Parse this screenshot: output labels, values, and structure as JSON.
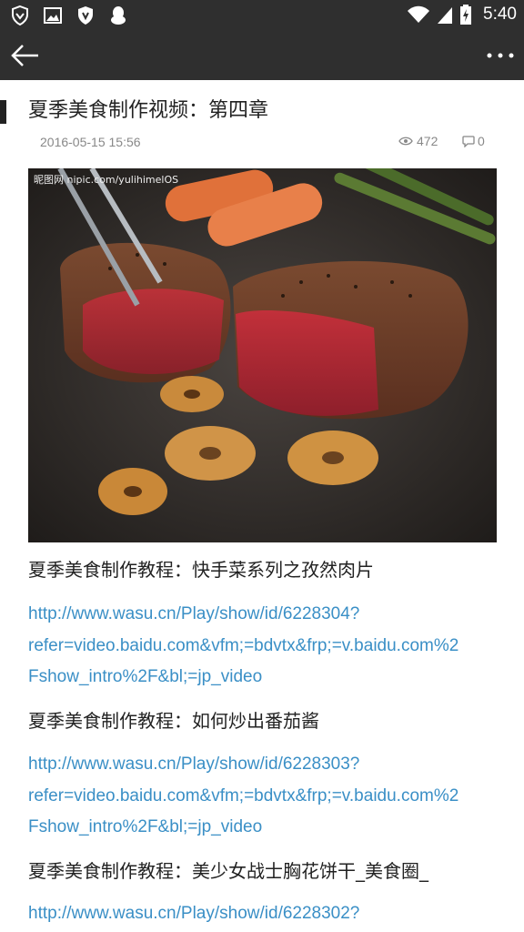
{
  "status_bar": {
    "time": "5:40",
    "left_icons": [
      "vpn-shield-icon",
      "image-notification-icon",
      "shield-notification-icon",
      "qq-penguin-icon"
    ],
    "right_icons": [
      "wifi-icon",
      "signal-icon",
      "battery-charging-icon"
    ]
  },
  "app_bar": {
    "back_icon": "arrow-left-icon",
    "more_icon": "more-dots-icon"
  },
  "article": {
    "title": "夏季美食制作视频：第四章",
    "date": "2016-05-15 15:56",
    "views": "472",
    "comments": "0",
    "image_watermark": "昵图网 nipic.com/yulihimelOS"
  },
  "sections": [
    {
      "title": "夏季美食制作教程：快手菜系列之孜然肉片",
      "link_lines": [
        "http://www.wasu.cn/Play/show/id/6228304?",
        "refer=video.baidu.com&vfm;=bdvtx&frp;=v.baidu.com%2",
        "Fshow_intro%2F&bl;=jp_video"
      ]
    },
    {
      "title": "夏季美食制作教程：如何炒出番茄酱",
      "link_lines": [
        "http://www.wasu.cn/Play/show/id/6228303?",
        "refer=video.baidu.com&vfm;=bdvtx&frp;=v.baidu.com%2",
        "Fshow_intro%2F&bl;=jp_video"
      ]
    },
    {
      "title": "夏季美食制作教程：美少女战士胸花饼干_美食圈_",
      "link_lines": [
        "http://www.wasu.cn/Play/show/id/6228302?"
      ]
    }
  ]
}
